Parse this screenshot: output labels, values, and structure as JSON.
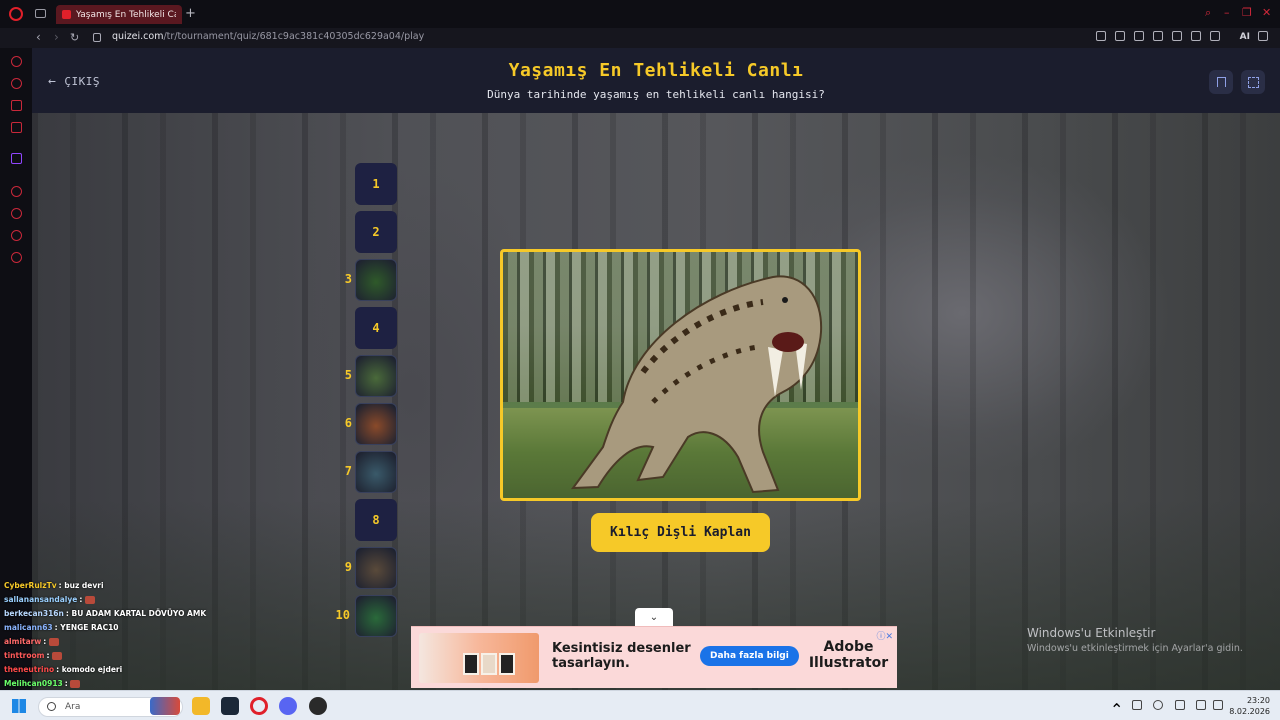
{
  "browser": {
    "tab_title": "Yaşamış En Tehlikeli Canlı",
    "new_tab": "+",
    "url_domain": "quizei.com",
    "url_path": "/tr/tournament/quiz/681c9ac381c40305dc629a04/play",
    "ai_label": "AI"
  },
  "header": {
    "exit_label": "ÇIKIŞ",
    "title": "Yaşamış En Tehlikeli Canlı",
    "subtitle": "Dünya tarihinde yaşamış en tehlikeli canlı hangisi?"
  },
  "bracket": {
    "slots": [
      {
        "number": "1",
        "has_image": false
      },
      {
        "number": "2",
        "has_image": false
      },
      {
        "number": "3",
        "has_image": true,
        "color": "#2f5a2a"
      },
      {
        "number": "4",
        "has_image": false
      },
      {
        "number": "5",
        "has_image": true,
        "color": "#4a6a3a"
      },
      {
        "number": "6",
        "has_image": true,
        "color": "#8a4a2a"
      },
      {
        "number": "7",
        "has_image": true,
        "color": "#3a5a6a"
      },
      {
        "number": "8",
        "has_image": false
      },
      {
        "number": "9",
        "has_image": true,
        "color": "#5a4a3a"
      },
      {
        "number": "10",
        "has_image": true,
        "color": "#2a6a3a"
      }
    ]
  },
  "main": {
    "answer_label": "Kılıç Dişli Kaplan",
    "accent": "#f6c928"
  },
  "ad": {
    "headline": "Kesintisiz desenler tasarlayın.",
    "cta": "Daha fazla bilgi",
    "brand": "Adobe Illustrator",
    "toggle_icon": "chevron-down-icon"
  },
  "watermark": {
    "line1": "Windows'u Etkinleştir",
    "line2": "Windows'u etkinleştirmek için Ayarlar'a gidin."
  },
  "chat": [
    {
      "user": "CyberRulzTv",
      "msg": "buz devri",
      "color": "#f6c928"
    },
    {
      "user": "sallanansandalye",
      "msg": "",
      "color": "#9ad0ff"
    },
    {
      "user": "berkecan316n",
      "msg": "BU ADAM KARTAL DÖVÜYO AMK",
      "color": "#b8d8ff"
    },
    {
      "user": "malicann63",
      "msg": "YENGE RAC10",
      "color": "#8ab4ff"
    },
    {
      "user": "almitarw",
      "msg": "",
      "color": "#ff6a6a"
    },
    {
      "user": "tinttroom",
      "msg": "",
      "color": "#ff5a5a"
    },
    {
      "user": "theneutrino",
      "msg": "komodo ejderi",
      "color": "#ff4a4a"
    },
    {
      "user": "Melihcan0913",
      "msg": "",
      "color": "#6aff6a"
    }
  ],
  "taskbar": {
    "search_placeholder": "Ara",
    "time": "23:20",
    "date": "8.02.2026"
  }
}
